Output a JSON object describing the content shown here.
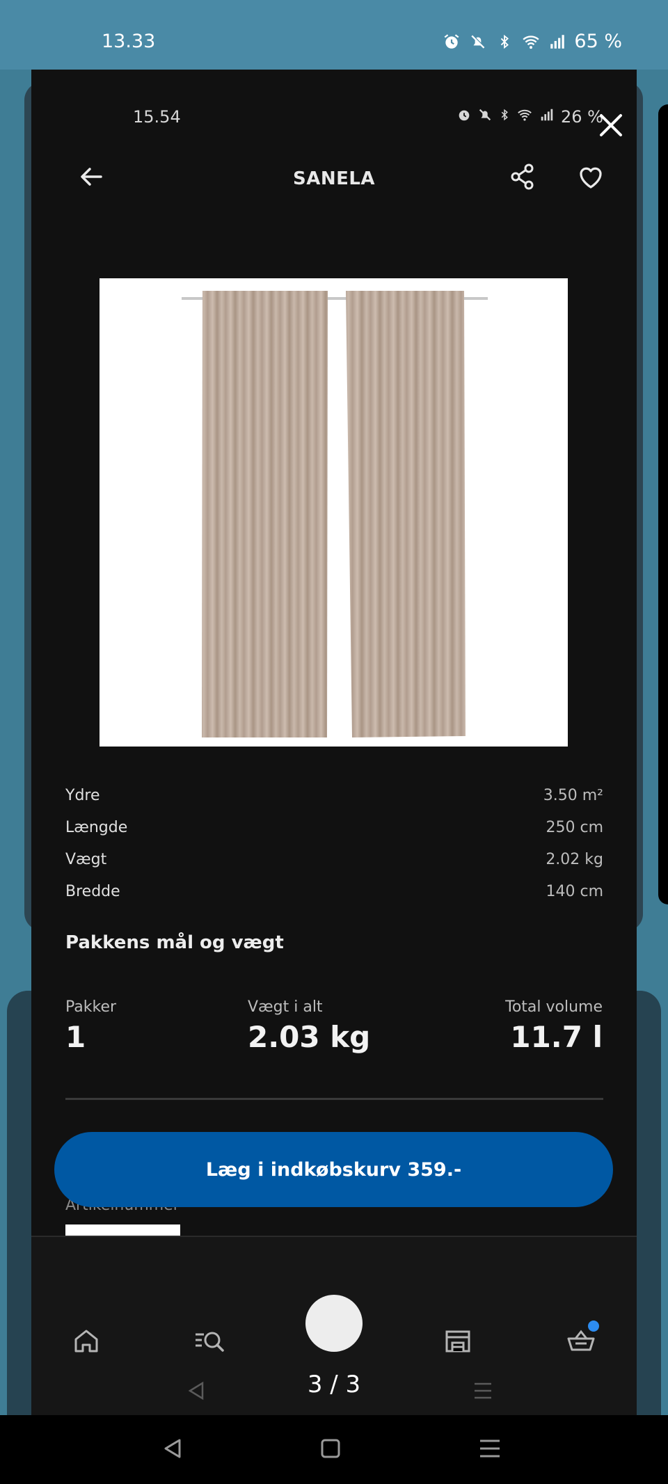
{
  "outer_status": {
    "time": "13.33",
    "battery": "65 %"
  },
  "inner_status": {
    "time": "15.54",
    "battery": "26 %"
  },
  "appbar": {
    "title": "SANELA"
  },
  "specs": [
    {
      "label": "Ydre",
      "value": "3.50 m²"
    },
    {
      "label": "Længde",
      "value": "250 cm"
    },
    {
      "label": "Vægt",
      "value": "2.02 kg"
    },
    {
      "label": "Bredde",
      "value": "140 cm"
    }
  ],
  "package": {
    "title": "Pakkens mål og vægt",
    "packages_label": "Pakker",
    "packages_value": "1",
    "weight_label": "Vægt i alt",
    "weight_value": "2.03 kg",
    "volume_label": "Total volume",
    "volume_value": "11.7 l"
  },
  "article": {
    "label": "Artikelnummer"
  },
  "cart_button": {
    "label": "Læg i indkøbskurv 359.-"
  },
  "viewer": {
    "pager": "3 / 3"
  },
  "colors": {
    "accent_blue": "#0058a3",
    "badge_blue": "#2d8cf0"
  },
  "icons": [
    "alarm-icon",
    "mute-icon",
    "bluetooth-icon",
    "wifi-icon",
    "signal-icon",
    "close-icon",
    "back-arrow-icon",
    "share-icon",
    "heart-icon",
    "home-icon",
    "search-list-icon",
    "store-icon",
    "basket-icon"
  ]
}
